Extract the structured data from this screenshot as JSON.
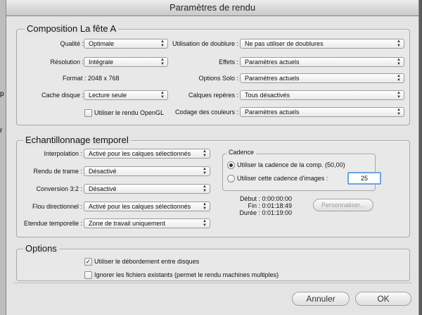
{
  "window": {
    "title": "Paramètres de rendu"
  },
  "background_app": {
    "hint_1": "p",
    "hint_2": "r"
  },
  "composition": {
    "title": "Composition La fête A",
    "qualite": {
      "label": "Qualité :",
      "value": "Optimale"
    },
    "resolution": {
      "label": "Résolution :",
      "value": "Intégrale"
    },
    "format": "Format : 2048 x 768",
    "cache": {
      "label": "Cache disque :",
      "value": "Lecture seule"
    },
    "opengl": {
      "label": "Utiliser le rendu OpenGL",
      "checked": false
    },
    "doublure": {
      "label": "Utilisation de doublure :",
      "value": "Ne pas utiliser de doublures"
    },
    "effets": {
      "label": "Effets :",
      "value": "Paramètres actuels"
    },
    "solo": {
      "label": "Options Solo :",
      "value": "Paramètres actuels"
    },
    "calques_reperes": {
      "label": "Calques repères :",
      "value": "Tous désactivés"
    },
    "codage": {
      "label": "Codage des couleurs :",
      "value": "Paramètres actuels"
    }
  },
  "echantillonnage": {
    "title": "Echantillonnage temporel",
    "interpolation": {
      "label": "Interpolation :",
      "value": "Activé pour les calques sélectionnés"
    },
    "trame": {
      "label": "Rendu de trame :",
      "value": "Désactivé"
    },
    "conversion": {
      "label": "Conversion 3:2 :",
      "value": "Désactivé"
    },
    "flou": {
      "label": "Flou directionnel :",
      "value": "Activé pour les calques sélectionnés"
    },
    "etendue": {
      "label": "Etendue temporelle :",
      "value": "Zone de travail uniquement"
    },
    "cadence": {
      "title": "Cadence",
      "option_comp": "Utiliser la cadence de la comp. (50,00)",
      "option_custom": "Utiliser cette cadence d'images :",
      "selected": "comp",
      "custom_value": "25"
    },
    "debut": "Début : 0:00:00:00",
    "fin": "Fin : 0:01:18:49",
    "duree": "Durée : 0:01:19:00",
    "personnaliser": "Personnaliser..."
  },
  "options": {
    "title": "Options",
    "debordement": {
      "label": "Utiliser le débordement entre disques",
      "checked": true
    },
    "ignorer": {
      "label": "Ignorer les fichiers existants (permet le rendu machines multiples)",
      "checked": false
    }
  },
  "buttons": {
    "annuler": "Annuler",
    "ok": "OK"
  },
  "icons": {
    "check": "✓",
    "popup_arrows": "▲▼"
  }
}
